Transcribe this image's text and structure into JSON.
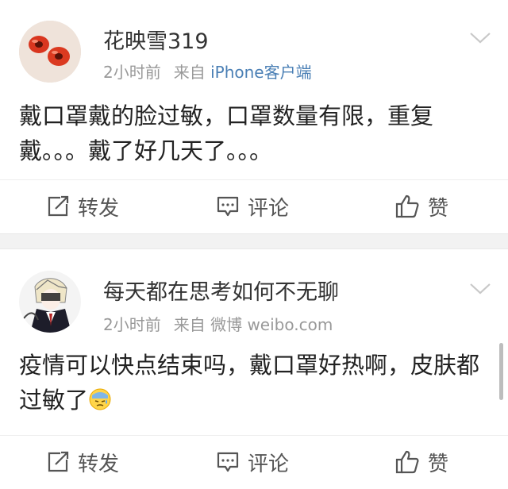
{
  "posts": [
    {
      "username": "花映雪319",
      "time": "2小时前",
      "source_prefix": "来自",
      "source_app": "iPhone客户端",
      "content": "戴口罩戴的脸过敏，口罩数量有限，重复戴。。。戴了好几天了。。。",
      "actions": {
        "repost": "转发",
        "comment": "评论",
        "like": "赞"
      }
    },
    {
      "username": "每天都在思考如何不无聊",
      "time": "2小时前",
      "source_prefix": "来自",
      "source_app": "微博 weibo.com",
      "content": "疫情可以快点结束吗，戴口罩好热啊，皮肤都过敏了",
      "actions": {
        "repost": "转发",
        "comment": "评论",
        "like": "赞"
      }
    }
  ],
  "colors": {
    "source_link": "#4a7fb5",
    "meta_gray": "#999999",
    "separator": "#f2f2f2"
  },
  "icons": [
    "chevron-down-icon",
    "repost-icon",
    "comment-icon",
    "like-icon",
    "sweat-emoji-icon"
  ]
}
